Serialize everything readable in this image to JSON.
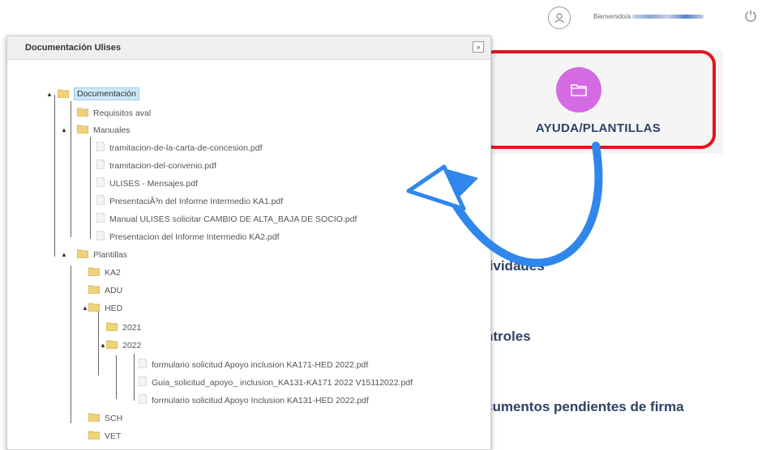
{
  "header": {
    "welcome": "Bienvenido/a"
  },
  "help_card": {
    "title": "AYUDA/PLANTILLAS",
    "icon": "folder-icon",
    "accent": "#d46be3",
    "highlight_color": "#e3141f"
  },
  "background_menu": {
    "item1": "tividades",
    "item2": "ntroles",
    "item3": "cumentos pendientes de firma"
  },
  "panel": {
    "title": "Documentación Ulises",
    "collapse_label": "»",
    "tree": {
      "root": "Documentación",
      "requisitos": "Requisitos aval",
      "manuales": "Manuales",
      "manuales_files": [
        "tramitacion-de-la-carta-de-concesion.pdf",
        "tramitacion-del-convenio.pdf",
        "ULISES - Mensajes.pdf",
        "PresentaciÃ³n del Informe Intermedio KA1.pdf",
        "Manual ULISES solicitar CAMBIO DE ALTA_BAJA DE SOCIO.pdf",
        "Presentacion del Informe Intermedio KA2.pdf"
      ],
      "plantillas": "Plantillas",
      "ka2": "KA2",
      "adu": "ADU",
      "hed": "HED",
      "y2021": "2021",
      "y2022": "2022",
      "files2022": [
        "formulario solicitud Apoyo inclusion KA171-HED 2022.pdf",
        "Guia_solicitud_apoyo_ inclusion_KA131-KA171 2022 V15112022.pdf",
        "formulario solicitud Apoyo Inclusion KA131-HED 2022.pdf"
      ],
      "sch": "SCH",
      "vet": "VET"
    }
  }
}
